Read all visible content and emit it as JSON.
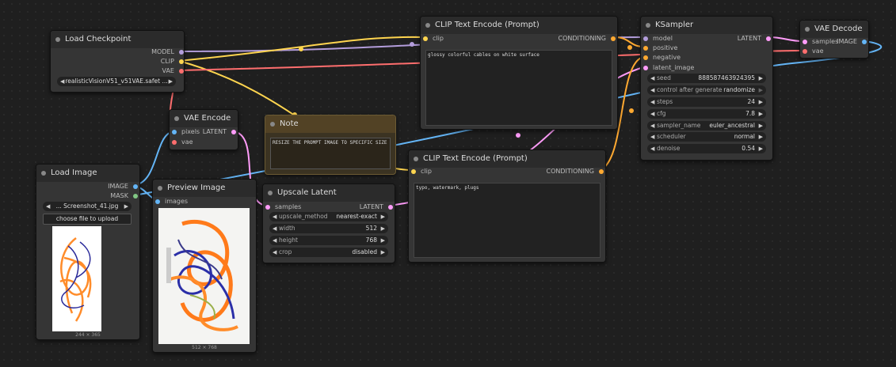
{
  "colors": {
    "model": "#b39ddb",
    "clip": "#ffd54f",
    "vae": "#ff6e6e",
    "latent": "#ff9cf9",
    "image": "#64b5f6",
    "mask": "#81c784",
    "conditioning": "#ffa931",
    "note_bg": "#3b3322",
    "note_title": "#524225"
  },
  "load_checkpoint": {
    "title": "Load Checkpoint",
    "out_model": "MODEL",
    "out_clip": "CLIP",
    "out_vae": "VAE",
    "ckpt_name": "realisticVisionV51_v51VAE.safet ..."
  },
  "vae_encode": {
    "title": "VAE Encode",
    "in_pixels": "pixels",
    "in_vae": "vae",
    "out_latent": "LATENT"
  },
  "note": {
    "title": "Note",
    "text": "RESIZE THE PROMPT IMAGE TO SPECIFIC SIZE"
  },
  "clip_pos": {
    "title": "CLIP Text Encode (Prompt)",
    "in_clip": "clip",
    "out": "CONDITIONING",
    "text": "glossy colorful cables on white surface"
  },
  "clip_neg": {
    "title": "CLIP Text Encode (Prompt)",
    "in_clip": "clip",
    "out": "CONDITIONING",
    "text": "typo, watermark, plugs"
  },
  "ksampler": {
    "title": "KSampler",
    "in_model": "model",
    "in_positive": "positive",
    "in_negative": "negative",
    "in_latent": "latent_image",
    "out_latent": "LATENT",
    "w_seed_l": "seed",
    "w_seed_v": "888587463924395",
    "w_cag_l": "control after generate",
    "w_cag_v": "randomize",
    "w_steps_l": "steps",
    "w_steps_v": "24",
    "w_cfg_l": "cfg",
    "w_cfg_v": "7.8",
    "w_sampler_l": "sampler_name",
    "w_sampler_v": "euler_ancestral",
    "w_sched_l": "scheduler",
    "w_sched_v": "normal",
    "w_denoise_l": "denoise",
    "w_denoise_v": "0.54"
  },
  "vae_decode": {
    "title": "VAE Decode",
    "in_samples": "samples",
    "in_vae": "vae",
    "out_image": "IMAGE"
  },
  "load_image": {
    "title": "Load Image",
    "out_image": "IMAGE",
    "out_mask": "MASK",
    "image_name": "... Screenshot_41.jpg",
    "upload": "choose file to upload",
    "dims": "244 × 365"
  },
  "preview_image": {
    "title": "Preview Image",
    "in_images": "images",
    "dims": "512 × 768"
  },
  "upscale": {
    "title": "Upscale Latent",
    "in_samples": "samples",
    "out_latent": "LATENT",
    "w_method_l": "upscale_method",
    "w_method_v": "nearest-exact",
    "w_width_l": "width",
    "w_width_v": "512",
    "w_height_l": "height",
    "w_height_v": "768",
    "w_crop_l": "crop",
    "w_crop_v": "disabled"
  }
}
